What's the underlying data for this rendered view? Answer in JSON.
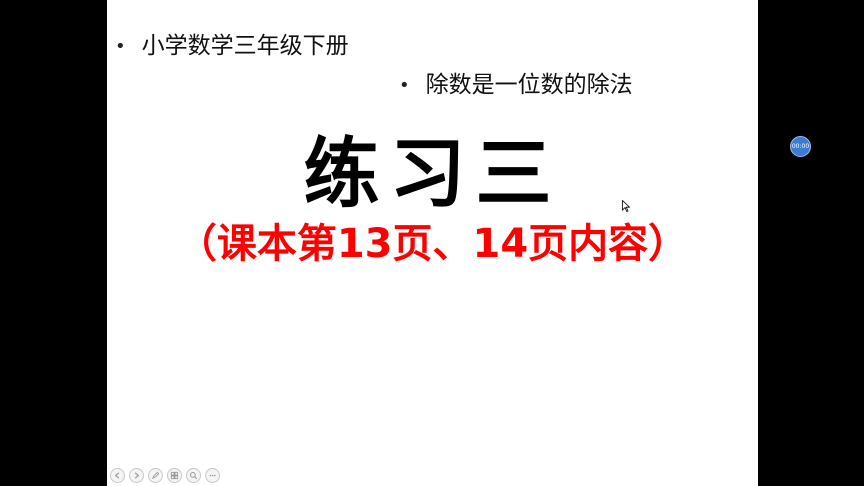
{
  "slide": {
    "bullet1": "小学数学三年级下册",
    "bullet2": "除数是一位数的除法",
    "bullet_symbol": "•",
    "title": "练习三",
    "subtitle": "（课本第13页、14页内容）"
  },
  "overlay": {
    "timer_label": "00:00"
  },
  "controls": {
    "icons": [
      "prev-icon",
      "next-icon",
      "pen-icon",
      "slides-icon",
      "zoom-icon",
      "more-icon"
    ]
  },
  "colors": {
    "subtitle": "#ff0000",
    "timer_badge": "#3a7bd5",
    "background": "#000000",
    "slide": "#ffffff"
  }
}
